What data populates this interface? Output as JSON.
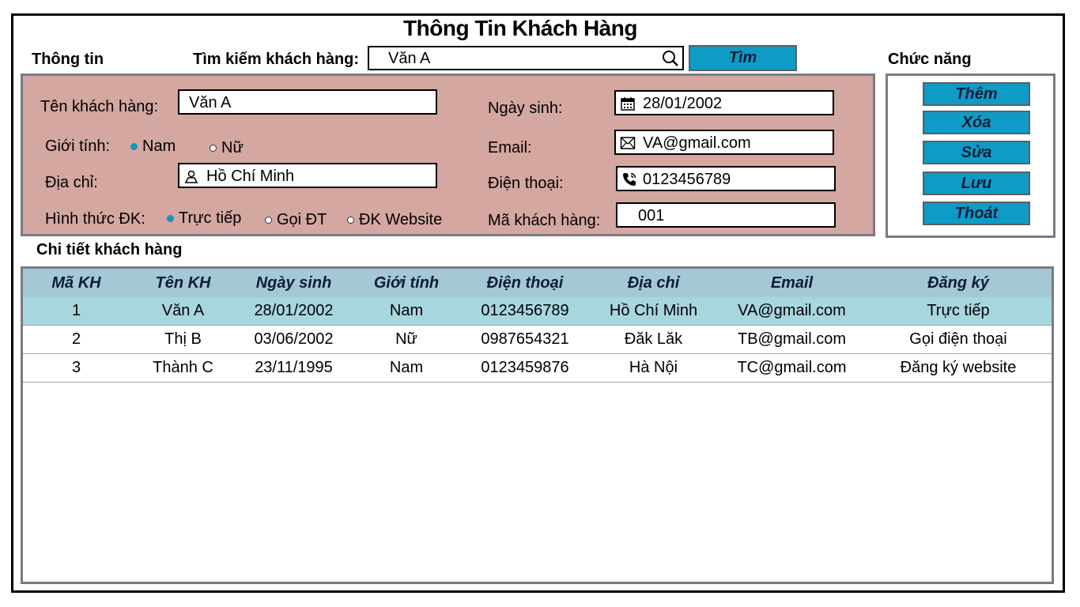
{
  "title": "Thông Tin Khách Hàng",
  "sections": {
    "info": "Thông tin",
    "functions": "Chức năng",
    "details": "Chi tiết khách hàng"
  },
  "search": {
    "label": "Tìm kiếm khách hàng:",
    "value": "Văn A",
    "button": "Tìm"
  },
  "form": {
    "name_label": "Tên khách hàng:",
    "name_value": "Văn A",
    "gender_label": "Giới tính:",
    "gender_options": [
      "Nam",
      "Nữ"
    ],
    "gender_selected": "Nam",
    "address_label": "Địa chỉ:",
    "address_value": "Hồ Chí Minh",
    "reg_label": "Hình thức ĐK:",
    "reg_options": [
      "Trực tiếp",
      "Gọi ĐT",
      "ĐK Website"
    ],
    "reg_selected": "Trực tiếp",
    "dob_label": "Ngày sinh:",
    "dob_value": "28/01/2002",
    "email_label": "Email:",
    "email_value": "VA@gmail.com",
    "phone_label": "Điện thoại:",
    "phone_value": "0123456789",
    "id_label": "Mã khách hàng:",
    "id_value": "001"
  },
  "buttons": {
    "add": "Thêm",
    "delete": "Xóa",
    "edit": "Sửa",
    "save": "Lưu",
    "exit": "Thoát"
  },
  "table": {
    "headers": [
      "Mã KH",
      "Tên KH",
      "Ngày sinh",
      "Giới tính",
      "Điện thoại",
      "Địa chỉ",
      "Email",
      "Đăng ký"
    ],
    "rows": [
      [
        "1",
        "Văn A",
        "28/01/2002",
        "Nam",
        "0123456789",
        "Hồ Chí Minh",
        "VA@gmail.com",
        "Trực tiếp"
      ],
      [
        "2",
        "Thị B",
        "03/06/2002",
        "Nữ",
        "0987654321",
        "Đăk Lăk",
        "TB@gmail.com",
        "Gọi điện thoại"
      ],
      [
        "3",
        "Thành C",
        "23/11/1995",
        "Nam",
        "0123459876",
        "Hà Nội",
        "TC@gmail.com",
        "Đăng ký website"
      ]
    ]
  },
  "icons": {
    "search": "magnifier-icon",
    "calendar": "calendar-icon",
    "mail": "envelope-icon",
    "phone": "phone-icon",
    "location": "location-pin-icon"
  },
  "colors": {
    "accent": "#0e9bc6",
    "info_panel": "#d4a7a1",
    "table_header": "#a4c8d5",
    "selected_row": "#a8d6df"
  }
}
